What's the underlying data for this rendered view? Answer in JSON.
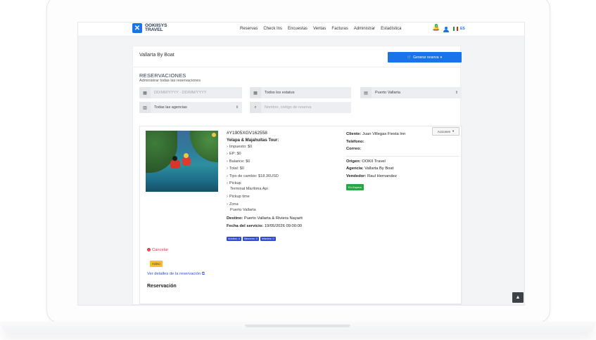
{
  "brand": {
    "name_line1": "OOKIISYS",
    "name_line2": "TRAVEL"
  },
  "nav": {
    "items": [
      "Reservas",
      "Check Ins",
      "Encuestas",
      "Ventas",
      "Facturas",
      "Administrar",
      "Estadística"
    ]
  },
  "notifications": {
    "count": "0"
  },
  "language": {
    "code": "ES"
  },
  "page": {
    "title": "Vallarta By Boat",
    "generate_button": "Generar reserva"
  },
  "section": {
    "title": "RESERVACIONES",
    "subtitle": "Administrar todas las reservaciones"
  },
  "filters": {
    "date_range_placeholder": "DD/MM/YYYY - DD/MM/YYYY",
    "status": "Todos los estatus",
    "location": "Puerto Vallarta",
    "agency": "Todas las agencias",
    "search_placeholder": "Nombre, código de reserva"
  },
  "reservation": {
    "code": "#Y1905XGV162558",
    "tour": "Yelapa & Majahuitas Tour:",
    "impuesto": "Impuesto: $0",
    "ep": "EP: $0",
    "balance": "Balance: $0",
    "total": "Total: $0",
    "tipo_cambio": "Tipo de cambio: $18.36USD",
    "pickup_label": "Pickup",
    "pickup_value": "Terminal Marítima Api",
    "pickup_time_label": "Pickup time",
    "zona_label": "Zona",
    "zona_value": "Puerto Vallarta",
    "destino_label": "Destino:",
    "destino_value": "Puerto Vallarta & Riviera Nayarit",
    "fecha_label": "Fecha del servicio:",
    "fecha_value": "19/05/2026 09:00:00",
    "pills": [
      "Adultos: 4",
      "Menores: 0",
      "Infantes: 0"
    ],
    "cliente_label": "Cliente:",
    "cliente_value": "Juan Villegas Fiesta Inn",
    "telefono_label": "Teléfono:",
    "correo_label": "Correo:",
    "origen_label": "Origen:",
    "origen_value": "OOKII Travel",
    "agencia_label": "Agencia:",
    "agencia_value": "Vallarta By Boat",
    "vendedor_label": "Vendedor:",
    "vendedor_value": "Raul Hernandez",
    "estado": "En Espera",
    "acciones": "Acciones",
    "cancelar": "Cancelar",
    "activo": "Activo",
    "ver_detalles": "Ver detalles de la reservación",
    "section_heading": "Reservación"
  },
  "colors": {
    "primary": "#1a73e8",
    "success": "#28a745",
    "warning": "#f5c023",
    "danger": "#dc3545",
    "pill": "#2f4ad0"
  }
}
